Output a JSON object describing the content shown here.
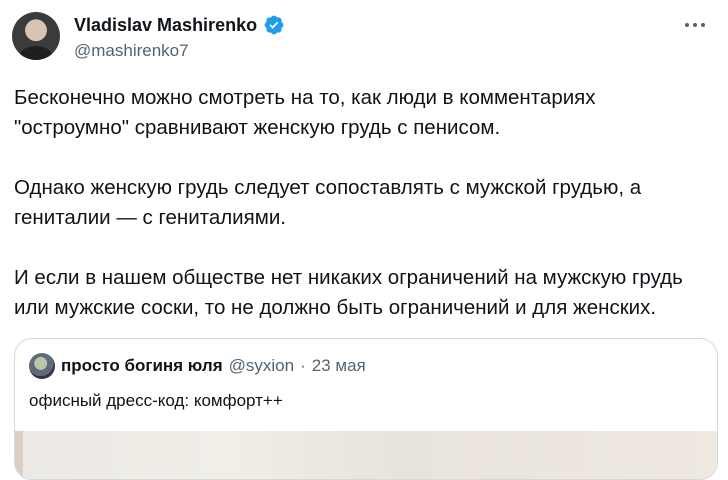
{
  "tweet": {
    "author_name": "Vladislav Mashirenko",
    "author_handle": "@mashirenko7",
    "paragraphs": [
      "Бесконечно можно смотреть на то, как люди в комментариях \"остроумно\" сравнивают женскую грудь с пенисом.",
      "Однако женскую грудь следует сопоставлять с мужской грудью, а гениталии — с гениталиями.",
      "И если в нашем обществе нет никаких ограничений на мужскую грудь или мужские соски, то не должно быть ограничений и для женских."
    ],
    "verified_color": "#1d9bf0",
    "more_icon": "more-horizontal-icon"
  },
  "quote": {
    "author_name": "просто богиня юля",
    "author_handle": "@syxion",
    "separator": "·",
    "date": "23 мая",
    "text": "офисный дресс-код: комфорт++"
  }
}
